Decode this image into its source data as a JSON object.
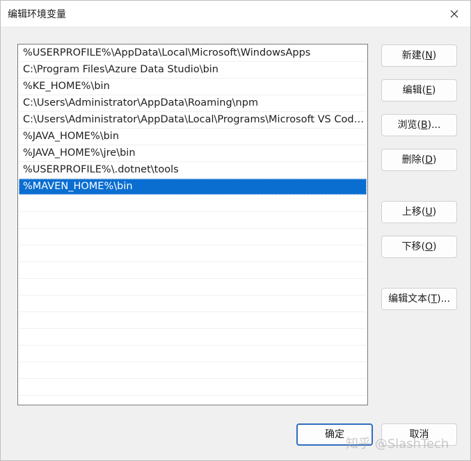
{
  "window": {
    "title": "编辑环境变量",
    "close_glyph": "✕"
  },
  "paths": [
    "%USERPROFILE%\\AppData\\Local\\Microsoft\\WindowsApps",
    "C:\\Program Files\\Azure Data Studio\\bin",
    "%KE_HOME%\\bin",
    "C:\\Users\\Administrator\\AppData\\Roaming\\npm",
    "C:\\Users\\Administrator\\AppData\\Local\\Programs\\Microsoft VS Code\\bin",
    "%JAVA_HOME%\\bin",
    "%JAVA_HOME%\\jre\\bin",
    "%USERPROFILE%\\.dotnet\\tools",
    "%MAVEN_HOME%\\bin"
  ],
  "selected_index": 8,
  "empty_row_count": 12,
  "buttons": {
    "new": {
      "pre": "新建(",
      "key": "N",
      "post": ")"
    },
    "edit": {
      "pre": "编辑(",
      "key": "E",
      "post": ")"
    },
    "browse": {
      "pre": "浏览(",
      "key": "B",
      "post": ")..."
    },
    "delete": {
      "pre": "删除(",
      "key": "D",
      "post": ")"
    },
    "move_up": {
      "pre": "上移(",
      "key": "U",
      "post": ")"
    },
    "move_down": {
      "pre": "下移(",
      "key": "O",
      "post": ")"
    },
    "edit_text": {
      "pre": "编辑文本(",
      "key": "T",
      "post": ")..."
    },
    "ok": "确定",
    "cancel": "取消"
  },
  "watermark": "知乎 @SlashTech",
  "colors": {
    "selection": "#0a6ed1",
    "default_button_border": "#2f6dbf"
  }
}
